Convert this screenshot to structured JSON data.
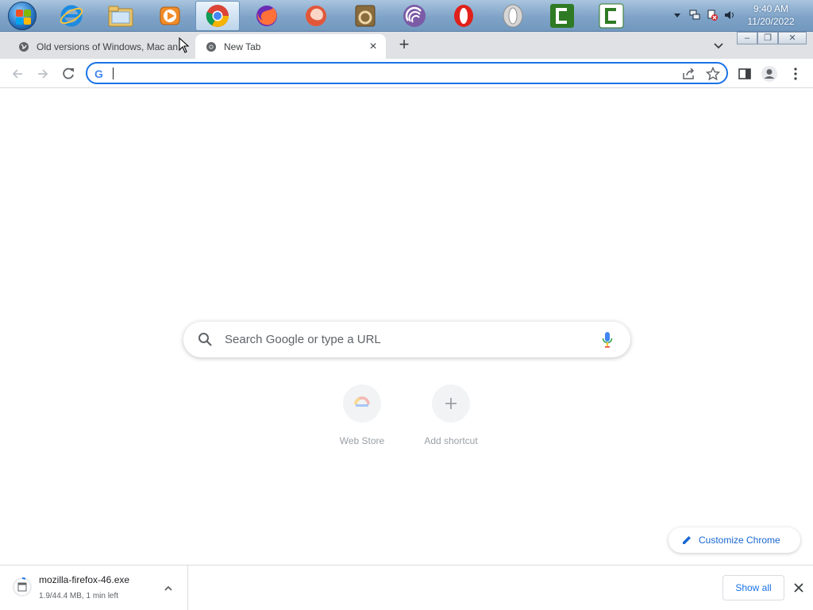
{
  "taskbar": {
    "apps": [
      {
        "name": "start-orb"
      },
      {
        "name": "internet-explorer-icon"
      },
      {
        "name": "file-explorer-icon"
      },
      {
        "name": "media-player-icon"
      },
      {
        "name": "chrome-icon",
        "active": true
      },
      {
        "name": "firefox-icon"
      },
      {
        "name": "pale-moon-icon"
      },
      {
        "name": "waterfox-icon"
      },
      {
        "name": "seamonkey-icon"
      },
      {
        "name": "opera-icon"
      },
      {
        "name": "opera-old-icon"
      },
      {
        "name": "camtasia-icon"
      },
      {
        "name": "camtasia-recorder-icon"
      }
    ],
    "clock": {
      "time": "9:40 AM",
      "date": "11/20/2022"
    }
  },
  "tabs": [
    {
      "title": "Old versions of Windows, Mac an",
      "active": false
    },
    {
      "title": "New Tab",
      "active": true
    }
  ],
  "omnibox": {
    "value": "",
    "placeholder": ""
  },
  "ntp": {
    "search_placeholder": "Search Google or type a URL",
    "shortcuts": [
      {
        "label": "Web Store",
        "icon": "web-store-icon"
      },
      {
        "label": "Add shortcut",
        "icon": "plus-icon"
      }
    ],
    "customize_label": "Customize Chrome"
  },
  "downloads": {
    "file_name": "mozilla-firefox-46.exe",
    "status": "1.9/44.4 MB, 1 min left",
    "show_all_label": "Show all"
  },
  "colors": {
    "accent": "#1a73e8",
    "tabstrip": "#dfe1e5",
    "taskbar": "#7fa3c7"
  }
}
